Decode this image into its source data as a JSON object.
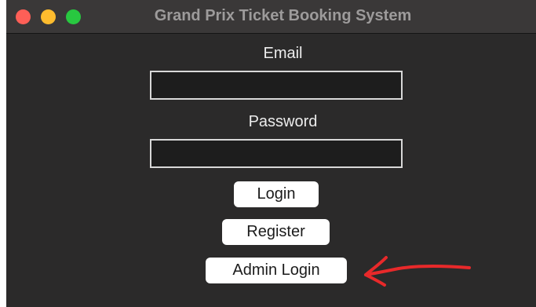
{
  "window": {
    "title": "Grand Prix Ticket Booking System"
  },
  "form": {
    "email_label": "Email",
    "email_value": "",
    "password_label": "Password",
    "password_value": ""
  },
  "buttons": {
    "login": "Login",
    "register": "Register",
    "admin_login": "Admin Login"
  },
  "colors": {
    "window_background": "#2b2a2a",
    "titlebar": "#3a3838",
    "close": "#fe5f57",
    "minimize": "#febc2e",
    "zoom": "#28c840",
    "annotation_arrow": "#e8292a"
  },
  "annotation": {
    "icon": "red-arrow-icon"
  }
}
